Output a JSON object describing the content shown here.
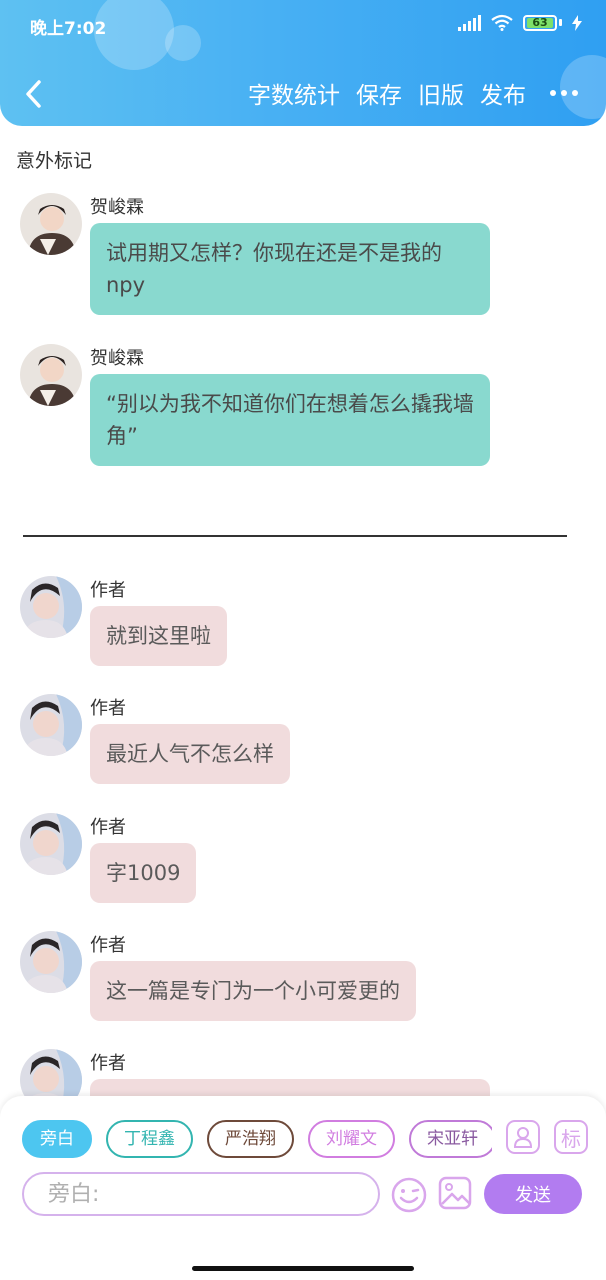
{
  "status_bar": {
    "time": "晚上7:02",
    "battery": "63"
  },
  "header": {
    "back_icon": "chevron-left-icon",
    "actions": [
      "字数统计",
      "保存",
      "旧版",
      "发布"
    ],
    "more_icon": "more-dots-icon",
    "colors": {
      "start": "#5ec1f2",
      "end": "#2f9ff2"
    }
  },
  "story": {
    "title": "意外标记"
  },
  "messages_before": [
    {
      "name": "贺峻霖",
      "text": "试用期又怎样？你现在还是不是我的npy"
    },
    {
      "name": "贺峻霖",
      "text": "“别以为我不知道你们在想着怎么撬我墙角”"
    }
  ],
  "messages_after": [
    {
      "name": "作者",
      "text": "就到这里啦"
    },
    {
      "name": "作者",
      "text": "最近人气不怎么样"
    },
    {
      "name": "作者",
      "text": "字1009"
    },
    {
      "name": "作者",
      "text": "这一篇是专门为一个小可爱更的"
    },
    {
      "name": "作者",
      "text": ""
    }
  ],
  "composer": {
    "chips": [
      "旁白",
      "丁程鑫",
      "严浩翔",
      "刘耀文",
      "宋亚轩"
    ],
    "chip_colors": [
      "#4dc6f0",
      "#33b5b0",
      "#6e4a3a",
      "#d17de0",
      "#c07ad8"
    ],
    "side_icon_labels": [
      "",
      "标"
    ],
    "input_placeholder": "旁白:",
    "send_label": "发送",
    "send_color": "#b27cf0"
  }
}
